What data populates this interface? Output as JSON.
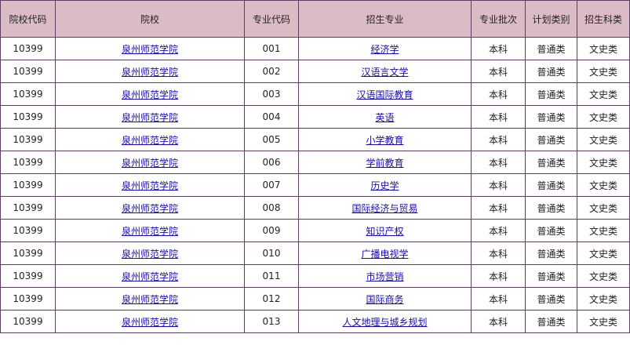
{
  "table": {
    "headers": [
      "院校代码",
      "院校",
      "专业代码",
      "招生专业",
      "专业批次",
      "计划类别",
      "招生科类"
    ],
    "rows": [
      {
        "school_code": "10399",
        "school": "泉州师范学院",
        "major_code": "001",
        "major": "经济学",
        "batch": "本科",
        "plan": "普通类",
        "category": "文史类"
      },
      {
        "school_code": "10399",
        "school": "泉州师范学院",
        "major_code": "002",
        "major": "汉语言文学",
        "batch": "本科",
        "plan": "普通类",
        "category": "文史类"
      },
      {
        "school_code": "10399",
        "school": "泉州师范学院",
        "major_code": "003",
        "major": "汉语国际教育",
        "batch": "本科",
        "plan": "普通类",
        "category": "文史类"
      },
      {
        "school_code": "10399",
        "school": "泉州师范学院",
        "major_code": "004",
        "major": "英语",
        "batch": "本科",
        "plan": "普通类",
        "category": "文史类"
      },
      {
        "school_code": "10399",
        "school": "泉州师范学院",
        "major_code": "005",
        "major": "小学教育",
        "batch": "本科",
        "plan": "普通类",
        "category": "文史类"
      },
      {
        "school_code": "10399",
        "school": "泉州师范学院",
        "major_code": "006",
        "major": "学前教育",
        "batch": "本科",
        "plan": "普通类",
        "category": "文史类"
      },
      {
        "school_code": "10399",
        "school": "泉州师范学院",
        "major_code": "007",
        "major": "历史学",
        "batch": "本科",
        "plan": "普通类",
        "category": "文史类"
      },
      {
        "school_code": "10399",
        "school": "泉州师范学院",
        "major_code": "008",
        "major": "国际经济与贸易",
        "batch": "本科",
        "plan": "普通类",
        "category": "文史类"
      },
      {
        "school_code": "10399",
        "school": "泉州师范学院",
        "major_code": "009",
        "major": "知识产权",
        "batch": "本科",
        "plan": "普通类",
        "category": "文史类"
      },
      {
        "school_code": "10399",
        "school": "泉州师范学院",
        "major_code": "010",
        "major": "广播电视学",
        "batch": "本科",
        "plan": "普通类",
        "category": "文史类"
      },
      {
        "school_code": "10399",
        "school": "泉州师范学院",
        "major_code": "011",
        "major": "市场营销",
        "batch": "本科",
        "plan": "普通类",
        "category": "文史类"
      },
      {
        "school_code": "10399",
        "school": "泉州师范学院",
        "major_code": "012",
        "major": "国际商务",
        "batch": "本科",
        "plan": "普通类",
        "category": "文史类"
      },
      {
        "school_code": "10399",
        "school": "泉州师范学院",
        "major_code": "013",
        "major": "人文地理与城乡规划",
        "batch": "本科",
        "plan": "普通类",
        "category": "文史类"
      }
    ]
  },
  "colors": {
    "header_bg": "#dbbcc4",
    "border": "#5a3f5e",
    "link": "#1a0dab"
  }
}
